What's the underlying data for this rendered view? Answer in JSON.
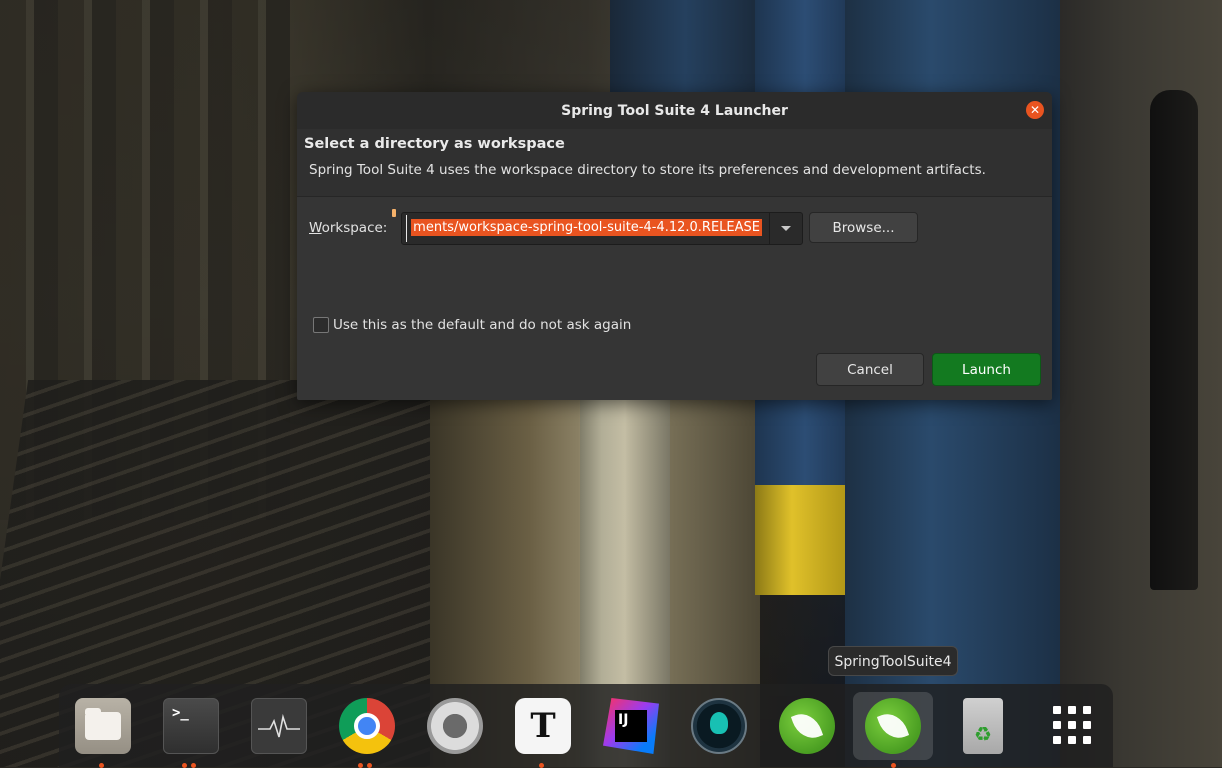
{
  "dialog": {
    "title": "Spring Tool Suite 4 Launcher",
    "heading": "Select a directory as workspace",
    "description": "Spring Tool Suite 4 uses the workspace directory to store its preferences and development artifacts.",
    "workspace_label_prefix": "W",
    "workspace_label_rest": "orkspace:",
    "workspace_value": "ments/workspace-spring-tool-suite-4-4.12.0.RELEASE",
    "browse_label": "Browse...",
    "default_checkbox_label": "Use this as the default and do not ask again",
    "default_checked": false,
    "cancel_label": "Cancel",
    "launch_label": "Launch",
    "close_icon": "close-icon",
    "accent_color": "#e95420",
    "launch_color": "#137a20"
  },
  "tooltip": "SpringToolSuite4",
  "dock": {
    "items": [
      {
        "name": "files",
        "icon": "folder-icon",
        "running_dots": 1
      },
      {
        "name": "terminal",
        "icon": "terminal-icon",
        "glyph": ">_",
        "running_dots": 2
      },
      {
        "name": "system-monitor",
        "icon": "system-monitor-icon",
        "running_dots": 0
      },
      {
        "name": "chrome",
        "icon": "chrome-icon",
        "running_dots": 2
      },
      {
        "name": "settings",
        "icon": "settings-icon",
        "running_dots": 0
      },
      {
        "name": "typora",
        "icon": "typora-icon",
        "glyph": "T",
        "running_dots": 1
      },
      {
        "name": "intellij",
        "icon": "intellij-icon",
        "glyph": "IJ",
        "running_dots": 0
      },
      {
        "name": "gitkraken",
        "icon": "gitkraken-icon",
        "running_dots": 0
      },
      {
        "name": "spring-tool-suite",
        "icon": "spring-leaf-icon",
        "running_dots": 0
      },
      {
        "name": "spring-tool-suite-4",
        "icon": "spring-leaf-icon",
        "running_dots": 1,
        "highlighted": true
      },
      {
        "name": "trash",
        "icon": "trash-icon",
        "glyph": "♻",
        "running_dots": 0
      },
      {
        "name": "show-applications",
        "icon": "app-grid-icon",
        "running_dots": 0
      }
    ]
  }
}
